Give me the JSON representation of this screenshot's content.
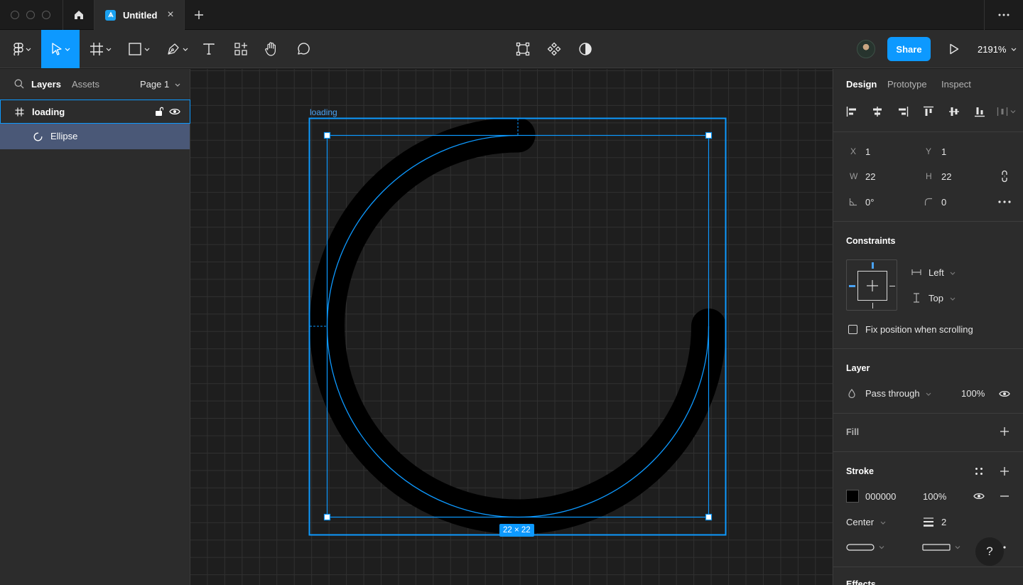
{
  "window": {
    "tab_title": "Untitled",
    "new_tab_symbol": "+",
    "close_symbol": "×"
  },
  "toolbar": {
    "share_label": "Share",
    "zoom_label": "2191%"
  },
  "left_panel": {
    "tabs": [
      "Layers",
      "Assets"
    ],
    "page_selector": "Page 1",
    "layers": [
      {
        "name": "loading",
        "type": "frame",
        "locked": false,
        "visible": true,
        "selected_parent": true
      },
      {
        "name": "Ellipse",
        "type": "ellipse",
        "selected": true
      }
    ]
  },
  "canvas": {
    "frame_label": "loading",
    "size_badge": "22 × 22",
    "accent_color": "#0d99ff"
  },
  "right_panel": {
    "tabs": [
      "Design",
      "Prototype",
      "Inspect"
    ],
    "position": {
      "x_label": "X",
      "x_value": "1",
      "y_label": "Y",
      "y_value": "1",
      "w_label": "W",
      "w_value": "22",
      "h_label": "H",
      "h_value": "22",
      "rotation_value": "0°",
      "radius_value": "0"
    },
    "constraints": {
      "title": "Constraints",
      "horizontal": "Left",
      "vertical": "Top",
      "fix_label": "Fix position when scrolling"
    },
    "layer": {
      "title": "Layer",
      "blend_mode": "Pass through",
      "opacity": "100%"
    },
    "fill": {
      "title": "Fill"
    },
    "stroke": {
      "title": "Stroke",
      "color_hex": "000000",
      "opacity": "100%",
      "align": "Center",
      "weight": "2"
    },
    "effects": {
      "title": "Effects"
    },
    "help_label": "?"
  }
}
